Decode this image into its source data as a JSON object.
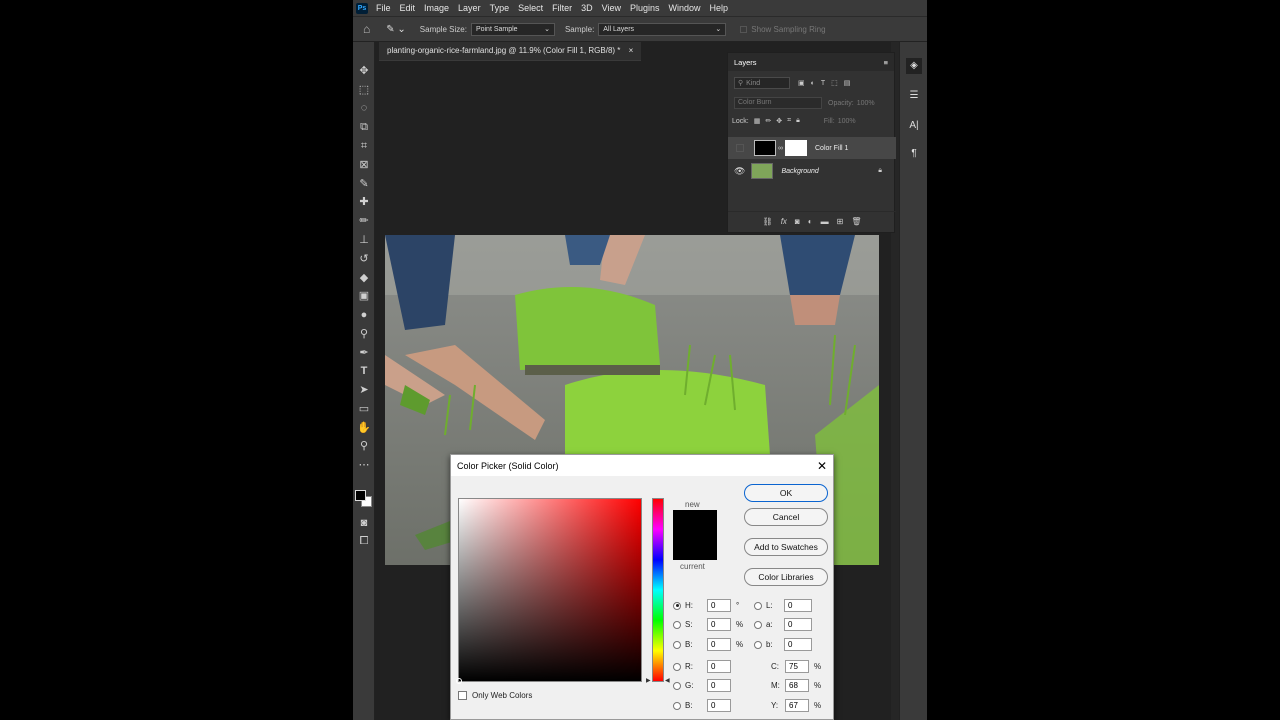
{
  "app": {
    "logo": "Ps"
  },
  "menu": [
    "File",
    "Edit",
    "Image",
    "Layer",
    "Type",
    "Select",
    "Filter",
    "3D",
    "View",
    "Plugins",
    "Window",
    "Help"
  ],
  "options": {
    "sample_size_label": "Sample Size:",
    "sample_size_value": "Point Sample",
    "sample_label": "Sample:",
    "sample_value": "All Layers",
    "show_ring_label": "Show Sampling Ring"
  },
  "document": {
    "tab_title": "planting-organic-rice-farmland.jpg @ 11.9% (Color Fill 1, RGB/8) *"
  },
  "layers_panel": {
    "title": "Layers",
    "filter_kind": "Kind",
    "blend_mode": "Color Burn",
    "opacity_label": "Opacity:",
    "opacity_value": "100%",
    "lock_label": "Lock:",
    "fill_label": "Fill:",
    "fill_value": "100%",
    "layers": [
      {
        "name": "Color Fill 1",
        "visible": false,
        "selected": true
      },
      {
        "name": "Background",
        "visible": true,
        "locked": true
      }
    ]
  },
  "color_picker": {
    "title": "Color Picker (Solid Color)",
    "buttons": {
      "ok": "OK",
      "cancel": "Cancel",
      "add_swatches": "Add to Swatches",
      "color_libraries": "Color Libraries"
    },
    "new_label": "new",
    "current_label": "current",
    "only_web_colors": "Only Web Colors",
    "hue_color": "#ff0000",
    "new_color": "#000000",
    "fields_left": [
      {
        "label": "H:",
        "value": "0",
        "unit": "°",
        "selected": true
      },
      {
        "label": "S:",
        "value": "0",
        "unit": "%"
      },
      {
        "label": "B:",
        "value": "0",
        "unit": "%"
      },
      {
        "label": "R:",
        "value": "0",
        "unit": ""
      },
      {
        "label": "G:",
        "value": "0",
        "unit": ""
      },
      {
        "label": "B:",
        "value": "0",
        "unit": ""
      }
    ],
    "fields_lab": [
      {
        "label": "L:",
        "value": "0"
      },
      {
        "label": "a:",
        "value": "0"
      },
      {
        "label": "b:",
        "value": "0"
      }
    ],
    "fields_cmyk": [
      {
        "label": "C:",
        "value": "75",
        "unit": "%"
      },
      {
        "label": "M:",
        "value": "68",
        "unit": "%"
      },
      {
        "label": "Y:",
        "value": "67",
        "unit": "%"
      }
    ]
  }
}
